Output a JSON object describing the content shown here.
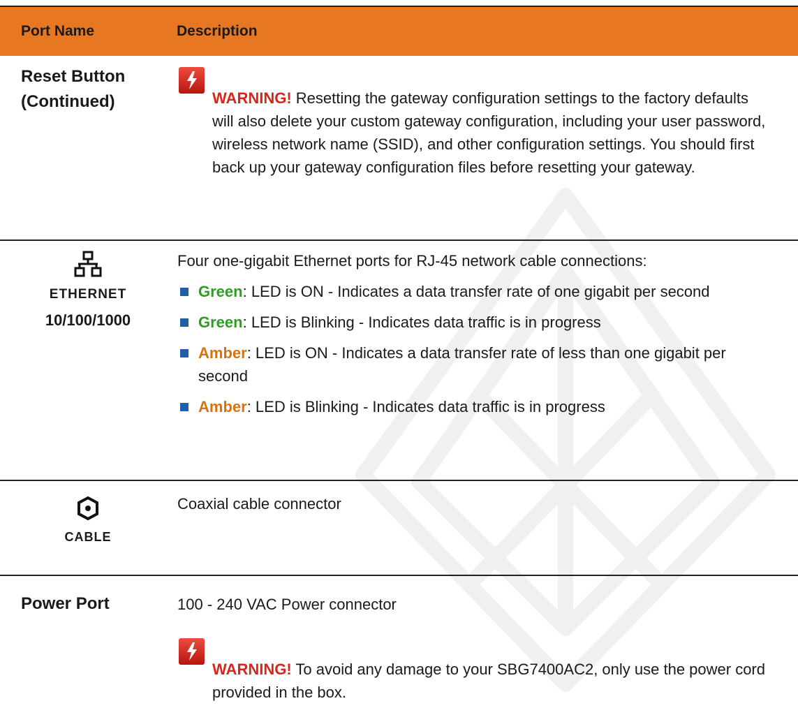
{
  "header": {
    "col_port_name": "Port Name",
    "col_description": "Description"
  },
  "rows": {
    "reset": {
      "name_line1": "Reset Button",
      "name_line2": "(Continued)",
      "warning_label": "WARNING!",
      "warning_text": "Resetting the gateway configuration settings to the factory defaults will also delete your custom gateway configuration, including your user password, wireless network name (SSID), and other configuration settings. You should first back up your gateway configuration files before resetting your gateway."
    },
    "ethernet": {
      "icon": "network-icon",
      "label": "ETHERNET",
      "speed": "10/100/1000",
      "intro": "Four one-gigabit Ethernet ports for RJ-45 network cable connections:",
      "bullets": [
        {
          "color_word": "Green",
          "text": ": LED is ON - Indicates a data transfer rate of one gigabit per second"
        },
        {
          "color_word": "Green",
          "text": ": LED is Blinking - Indicates data traffic is in progress"
        },
        {
          "color_word": "Amber",
          "text": ": LED is ON - Indicates a data transfer rate of less than one gigabit per second"
        },
        {
          "color_word": "Amber",
          "text": ": LED is Blinking - Indicates data traffic is in progress"
        }
      ]
    },
    "cable": {
      "icon": "coax-connector-icon",
      "label": "CABLE",
      "description": "Coaxial cable connector"
    },
    "power": {
      "name": "Power Port",
      "description": "100 - 240 VAC Power connector",
      "warning_label": "WARNING!",
      "warning_text": "To avoid any damage to your SBG7400AC2, only use the power cord provided in the box."
    }
  },
  "colors": {
    "header_bg": "#e87722",
    "warning": "#d9251c",
    "green": "#2d9e1f",
    "amber": "#d8720f",
    "bullet": "#1f5fa8"
  }
}
